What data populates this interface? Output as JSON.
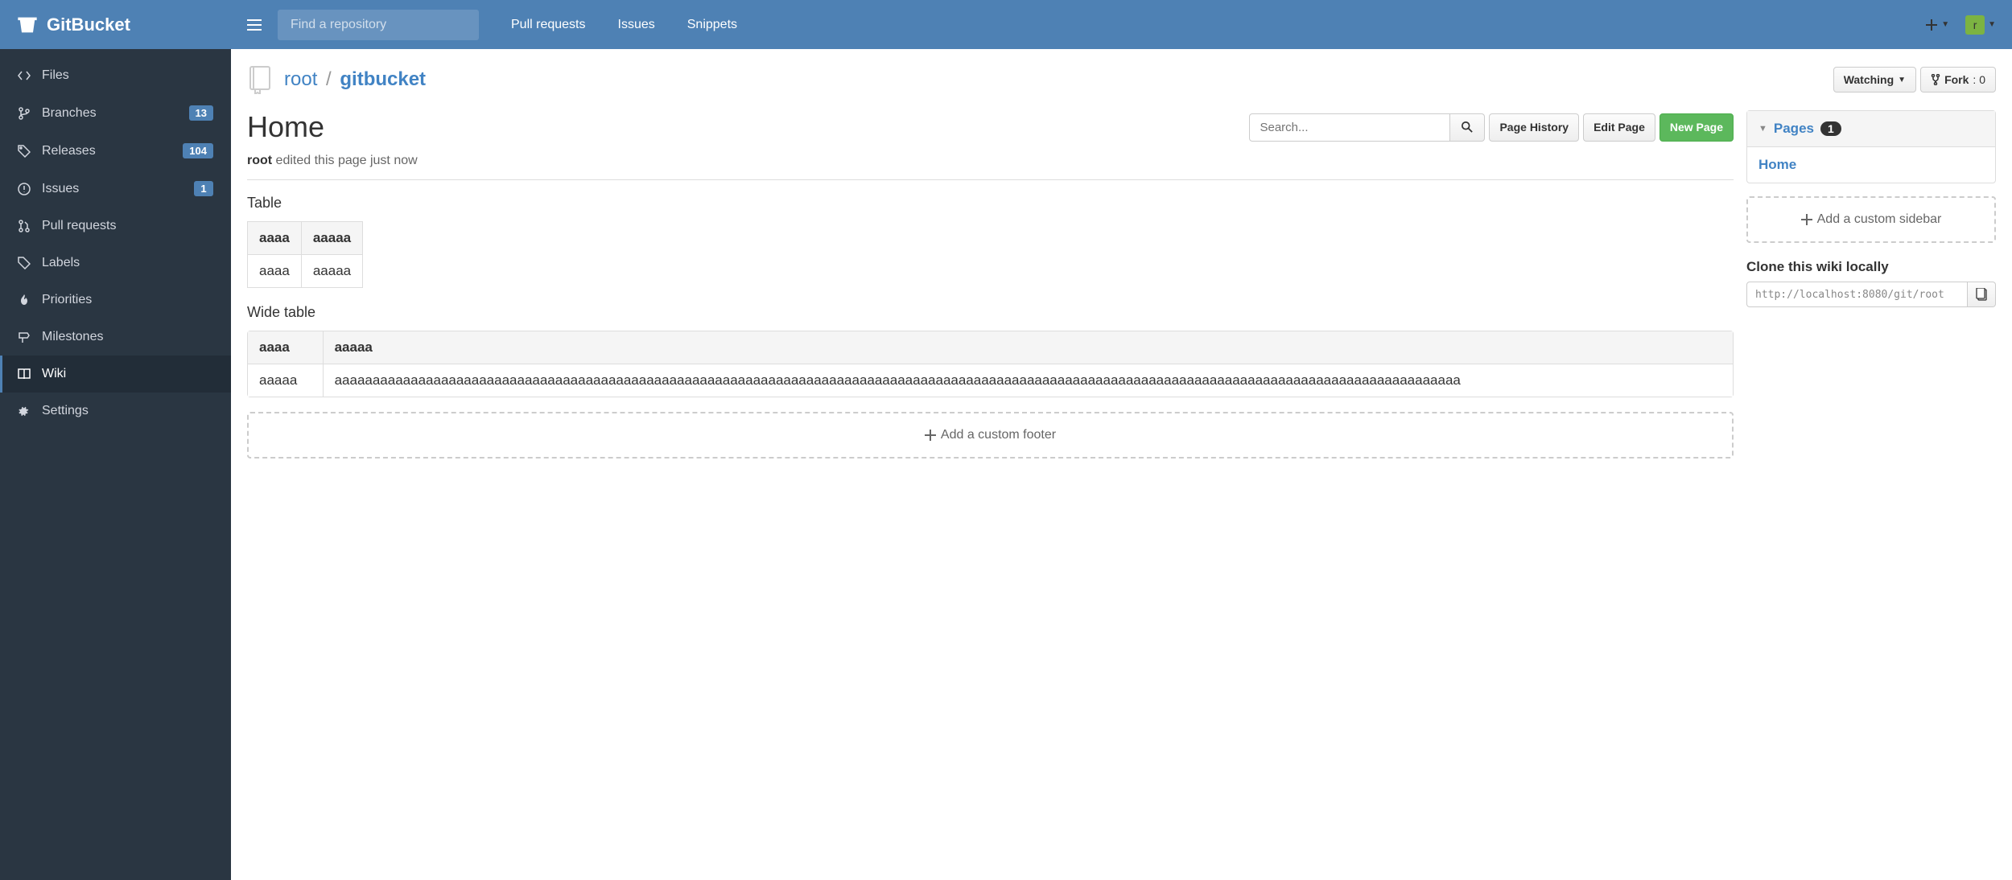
{
  "brand": "GitBucket",
  "search_placeholder": "Find a repository",
  "topnav": {
    "pull_requests": "Pull requests",
    "issues": "Issues",
    "snippets": "Snippets"
  },
  "user_initial": "r",
  "sidebar": {
    "files": "Files",
    "branches": "Branches",
    "branches_count": "13",
    "releases": "Releases",
    "releases_count": "104",
    "issues": "Issues",
    "issues_count": "1",
    "pull_requests": "Pull requests",
    "labels": "Labels",
    "priorities": "Priorities",
    "milestones": "Milestones",
    "wiki": "Wiki",
    "settings": "Settings"
  },
  "repo": {
    "owner": "root",
    "name": "gitbucket"
  },
  "repo_buttons": {
    "watching": "Watching",
    "fork": "Fork",
    "fork_count": ": 0"
  },
  "page": {
    "title": "Home",
    "search_placeholder": "Search...",
    "history": "Page History",
    "edit": "Edit Page",
    "new": "New Page",
    "editor": "root",
    "edited_text": " edited this page just now"
  },
  "wiki": {
    "table_heading": "Table",
    "table1": {
      "h1": "aaaa",
      "h2": "aaaaa",
      "c1": "aaaa",
      "c2": "aaaaa"
    },
    "wide_heading": "Wide table",
    "table2": {
      "h1": "aaaa",
      "h2": "aaaaa",
      "c1": "aaaaa",
      "c2": "aaaaaaaaaaaaaaaaaaaaaaaaaaaaaaaaaaaaaaaaaaaaaaaaaaaaaaaaaaaaaaaaaaaaaaaaaaaaaaaaaaaaaaaaaaaaaaaaaaaaaaaaaaaaaaaaaaaaaaaaaaaaaaaaaaaaaaaaaaaaaaaaaaaa"
    },
    "add_footer": "Add a custom footer"
  },
  "side": {
    "pages_label": "Pages",
    "pages_count": "1",
    "page_link": "Home",
    "add_sidebar": "Add a custom sidebar",
    "clone_title": "Clone this wiki locally",
    "clone_url": "http://localhost:8080/git/root"
  }
}
